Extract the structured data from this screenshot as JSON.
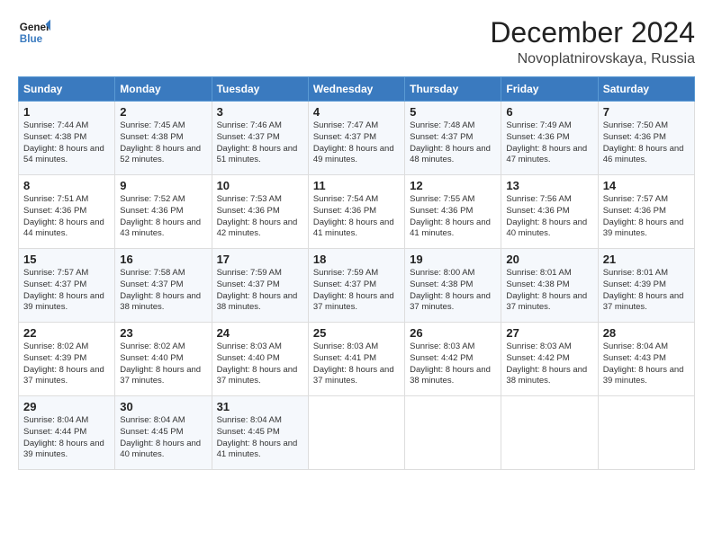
{
  "header": {
    "logo_line1": "General",
    "logo_line2": "Blue",
    "month": "December 2024",
    "location": "Novoplatnirovskaya, Russia"
  },
  "days_of_week": [
    "Sunday",
    "Monday",
    "Tuesday",
    "Wednesday",
    "Thursday",
    "Friday",
    "Saturday"
  ],
  "weeks": [
    [
      {
        "day": "1",
        "sunrise": "Sunrise: 7:44 AM",
        "sunset": "Sunset: 4:38 PM",
        "daylight": "Daylight: 8 hours and 54 minutes."
      },
      {
        "day": "2",
        "sunrise": "Sunrise: 7:45 AM",
        "sunset": "Sunset: 4:38 PM",
        "daylight": "Daylight: 8 hours and 52 minutes."
      },
      {
        "day": "3",
        "sunrise": "Sunrise: 7:46 AM",
        "sunset": "Sunset: 4:37 PM",
        "daylight": "Daylight: 8 hours and 51 minutes."
      },
      {
        "day": "4",
        "sunrise": "Sunrise: 7:47 AM",
        "sunset": "Sunset: 4:37 PM",
        "daylight": "Daylight: 8 hours and 49 minutes."
      },
      {
        "day": "5",
        "sunrise": "Sunrise: 7:48 AM",
        "sunset": "Sunset: 4:37 PM",
        "daylight": "Daylight: 8 hours and 48 minutes."
      },
      {
        "day": "6",
        "sunrise": "Sunrise: 7:49 AM",
        "sunset": "Sunset: 4:36 PM",
        "daylight": "Daylight: 8 hours and 47 minutes."
      },
      {
        "day": "7",
        "sunrise": "Sunrise: 7:50 AM",
        "sunset": "Sunset: 4:36 PM",
        "daylight": "Daylight: 8 hours and 46 minutes."
      }
    ],
    [
      {
        "day": "8",
        "sunrise": "Sunrise: 7:51 AM",
        "sunset": "Sunset: 4:36 PM",
        "daylight": "Daylight: 8 hours and 44 minutes."
      },
      {
        "day": "9",
        "sunrise": "Sunrise: 7:52 AM",
        "sunset": "Sunset: 4:36 PM",
        "daylight": "Daylight: 8 hours and 43 minutes."
      },
      {
        "day": "10",
        "sunrise": "Sunrise: 7:53 AM",
        "sunset": "Sunset: 4:36 PM",
        "daylight": "Daylight: 8 hours and 42 minutes."
      },
      {
        "day": "11",
        "sunrise": "Sunrise: 7:54 AM",
        "sunset": "Sunset: 4:36 PM",
        "daylight": "Daylight: 8 hours and 41 minutes."
      },
      {
        "day": "12",
        "sunrise": "Sunrise: 7:55 AM",
        "sunset": "Sunset: 4:36 PM",
        "daylight": "Daylight: 8 hours and 41 minutes."
      },
      {
        "day": "13",
        "sunrise": "Sunrise: 7:56 AM",
        "sunset": "Sunset: 4:36 PM",
        "daylight": "Daylight: 8 hours and 40 minutes."
      },
      {
        "day": "14",
        "sunrise": "Sunrise: 7:57 AM",
        "sunset": "Sunset: 4:36 PM",
        "daylight": "Daylight: 8 hours and 39 minutes."
      }
    ],
    [
      {
        "day": "15",
        "sunrise": "Sunrise: 7:57 AM",
        "sunset": "Sunset: 4:37 PM",
        "daylight": "Daylight: 8 hours and 39 minutes."
      },
      {
        "day": "16",
        "sunrise": "Sunrise: 7:58 AM",
        "sunset": "Sunset: 4:37 PM",
        "daylight": "Daylight: 8 hours and 38 minutes."
      },
      {
        "day": "17",
        "sunrise": "Sunrise: 7:59 AM",
        "sunset": "Sunset: 4:37 PM",
        "daylight": "Daylight: 8 hours and 38 minutes."
      },
      {
        "day": "18",
        "sunrise": "Sunrise: 7:59 AM",
        "sunset": "Sunset: 4:37 PM",
        "daylight": "Daylight: 8 hours and 37 minutes."
      },
      {
        "day": "19",
        "sunrise": "Sunrise: 8:00 AM",
        "sunset": "Sunset: 4:38 PM",
        "daylight": "Daylight: 8 hours and 37 minutes."
      },
      {
        "day": "20",
        "sunrise": "Sunrise: 8:01 AM",
        "sunset": "Sunset: 4:38 PM",
        "daylight": "Daylight: 8 hours and 37 minutes."
      },
      {
        "day": "21",
        "sunrise": "Sunrise: 8:01 AM",
        "sunset": "Sunset: 4:39 PM",
        "daylight": "Daylight: 8 hours and 37 minutes."
      }
    ],
    [
      {
        "day": "22",
        "sunrise": "Sunrise: 8:02 AM",
        "sunset": "Sunset: 4:39 PM",
        "daylight": "Daylight: 8 hours and 37 minutes."
      },
      {
        "day": "23",
        "sunrise": "Sunrise: 8:02 AM",
        "sunset": "Sunset: 4:40 PM",
        "daylight": "Daylight: 8 hours and 37 minutes."
      },
      {
        "day": "24",
        "sunrise": "Sunrise: 8:03 AM",
        "sunset": "Sunset: 4:40 PM",
        "daylight": "Daylight: 8 hours and 37 minutes."
      },
      {
        "day": "25",
        "sunrise": "Sunrise: 8:03 AM",
        "sunset": "Sunset: 4:41 PM",
        "daylight": "Daylight: 8 hours and 37 minutes."
      },
      {
        "day": "26",
        "sunrise": "Sunrise: 8:03 AM",
        "sunset": "Sunset: 4:42 PM",
        "daylight": "Daylight: 8 hours and 38 minutes."
      },
      {
        "day": "27",
        "sunrise": "Sunrise: 8:03 AM",
        "sunset": "Sunset: 4:42 PM",
        "daylight": "Daylight: 8 hours and 38 minutes."
      },
      {
        "day": "28",
        "sunrise": "Sunrise: 8:04 AM",
        "sunset": "Sunset: 4:43 PM",
        "daylight": "Daylight: 8 hours and 39 minutes."
      }
    ],
    [
      {
        "day": "29",
        "sunrise": "Sunrise: 8:04 AM",
        "sunset": "Sunset: 4:44 PM",
        "daylight": "Daylight: 8 hours and 39 minutes."
      },
      {
        "day": "30",
        "sunrise": "Sunrise: 8:04 AM",
        "sunset": "Sunset: 4:45 PM",
        "daylight": "Daylight: 8 hours and 40 minutes."
      },
      {
        "day": "31",
        "sunrise": "Sunrise: 8:04 AM",
        "sunset": "Sunset: 4:45 PM",
        "daylight": "Daylight: 8 hours and 41 minutes."
      },
      null,
      null,
      null,
      null
    ]
  ]
}
